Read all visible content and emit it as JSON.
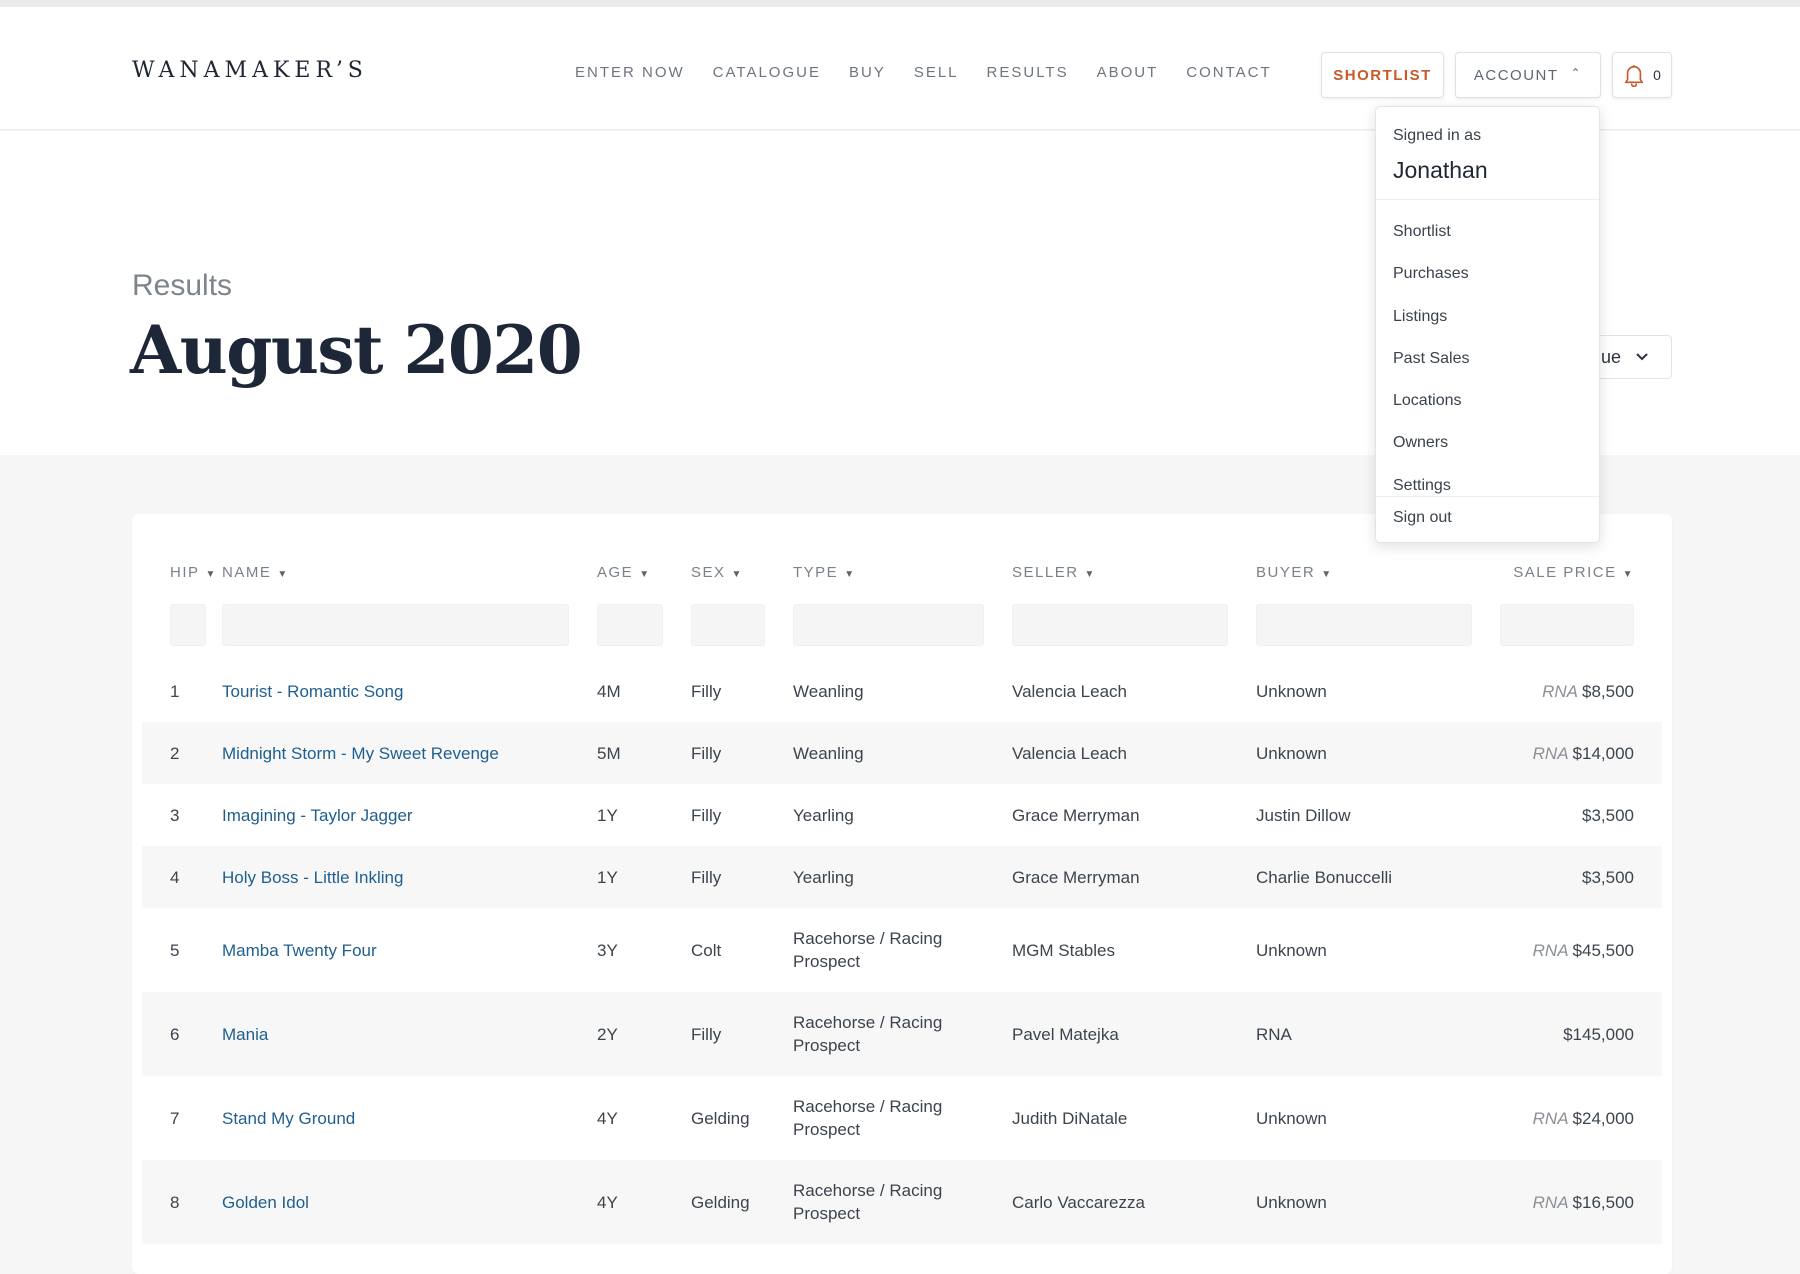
{
  "brand": {
    "logo": "WANAMAKER’S"
  },
  "nav": [
    "ENTER NOW",
    "CATALOGUE",
    "BUY",
    "SELL",
    "RESULTS",
    "ABOUT",
    "CONTACT"
  ],
  "header_actions": {
    "shortlist": "SHORTLIST",
    "account": "ACCOUNT",
    "account_chevron": "^",
    "notifications_count": "0",
    "icon": "bell-icon"
  },
  "page": {
    "kicker": "Results",
    "title": "August 2020",
    "venue_select": "ue"
  },
  "account_menu": {
    "signed_in_label": "Signed in as",
    "username": "Jonathan",
    "items": [
      "Shortlist",
      "Purchases",
      "Listings",
      "Past Sales",
      "Locations",
      "Owners",
      "Settings"
    ],
    "sign_out": "Sign out"
  },
  "table": {
    "columns": [
      "HIP",
      "NAME",
      "AGE",
      "SEX",
      "TYPE",
      "SELLER",
      "BUYER",
      "SALE PRICE"
    ],
    "rows": [
      {
        "hip": "1",
        "name": "Tourist - Romantic Song",
        "age": "4M",
        "sex": "Filly",
        "type": "Weanling",
        "seller": "Valencia Leach",
        "buyer": "Unknown",
        "rna": "RNA",
        "price": "$8,500"
      },
      {
        "hip": "2",
        "name": "Midnight Storm - My Sweet Revenge",
        "age": "5M",
        "sex": "Filly",
        "type": "Weanling",
        "seller": "Valencia Leach",
        "buyer": "Unknown",
        "rna": "RNA",
        "price": "$14,000"
      },
      {
        "hip": "3",
        "name": "Imagining - Taylor Jagger",
        "age": "1Y",
        "sex": "Filly",
        "type": "Yearling",
        "seller": "Grace Merryman",
        "buyer": "Justin Dillow",
        "rna": "",
        "price": "$3,500"
      },
      {
        "hip": "4",
        "name": "Holy Boss - Little Inkling",
        "age": "1Y",
        "sex": "Filly",
        "type": "Yearling",
        "seller": "Grace Merryman",
        "buyer": "Charlie Bonuccelli",
        "rna": "",
        "price": "$3,500"
      },
      {
        "hip": "5",
        "name": "Mamba Twenty Four",
        "age": "3Y",
        "sex": "Colt",
        "type": "Racehorse / Racing Prospect",
        "seller": "MGM Stables",
        "buyer": "Unknown",
        "rna": "RNA",
        "price": "$45,500"
      },
      {
        "hip": "6",
        "name": "Mania",
        "age": "2Y",
        "sex": "Filly",
        "type": "Racehorse / Racing Prospect",
        "seller": "Pavel Matejka",
        "buyer": "RNA",
        "rna": "",
        "price": "$145,000"
      },
      {
        "hip": "7",
        "name": "Stand My Ground",
        "age": "4Y",
        "sex": "Gelding",
        "type": "Racehorse / Racing Prospect",
        "seller": "Judith DiNatale",
        "buyer": "Unknown",
        "rna": "RNA",
        "price": "$24,000"
      },
      {
        "hip": "8",
        "name": "Golden Idol",
        "age": "4Y",
        "sex": "Gelding",
        "type": "Racehorse / Racing Prospect",
        "seller": "Carlo Vaccarezza",
        "buyer": "Unknown",
        "rna": "RNA",
        "price": "$16,500"
      }
    ]
  },
  "colors": {
    "accent": "#c65a29",
    "link": "#1f5f8f",
    "title": "#1e2737"
  }
}
